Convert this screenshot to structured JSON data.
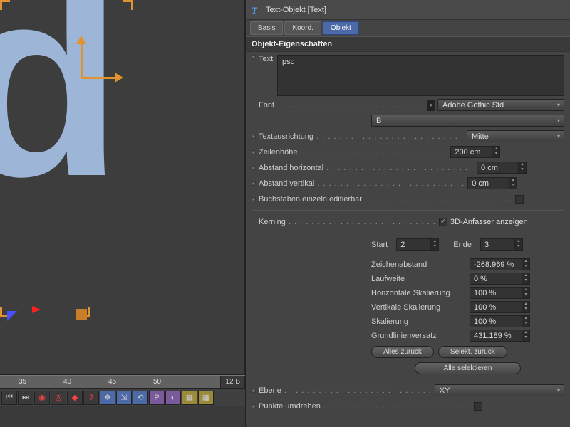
{
  "viewport": {
    "letter": "d",
    "ruler": {
      "t35": "35",
      "t40": "40",
      "t45": "45",
      "t50": "50",
      "badge": "12 B"
    }
  },
  "panel": {
    "title": "Text-Objekt [Text]",
    "tabs": {
      "basis": "Basis",
      "koord": "Koord.",
      "objekt": "Objekt"
    },
    "section": "Objekt-Eigenschaften",
    "text_label": "Text",
    "text_value": "psd",
    "font_label": "Font",
    "font_value": "Adobe Gothic Std",
    "font_weight": "B",
    "align_label": "Textausrichtung",
    "align_value": "Mitte",
    "lineheight_label": "Zeilenhöhe",
    "lineheight_value": "200 cm",
    "hspace_label": "Abstand horizontal",
    "hspace_value": "0 cm",
    "vspace_label": "Abstand vertikal",
    "vspace_value": "0 cm",
    "perchar_label": "Buchstaben einzeln editierbar",
    "kerning_label": "Kerning",
    "show3d_label": "3D-Anfasser anzeigen",
    "start_label": "Start",
    "start_value": "2",
    "end_label": "Ende",
    "end_value": "3",
    "charspace_label": "Zeichenabstand",
    "charspace_value": "-268.969 %",
    "tracking_label": "Laufweite",
    "tracking_value": "0 %",
    "hscale_label": "Horizontale Skalierung",
    "hscale_value": "100 %",
    "vscale_label": "Vertikale Skalierung",
    "vscale_value": "100 %",
    "scale_label": "Skalierung",
    "scale_value": "100 %",
    "baseline_label": "Grundlinienversatz",
    "baseline_value": "431.189 %",
    "reset_all": "Alles zurück",
    "reset_sel": "Selekt. zurück",
    "sel_all": "Alle selektieren",
    "plane_label": "Ebene",
    "plane_value": "XY",
    "reverse_label": "Punkte umdrehen"
  }
}
